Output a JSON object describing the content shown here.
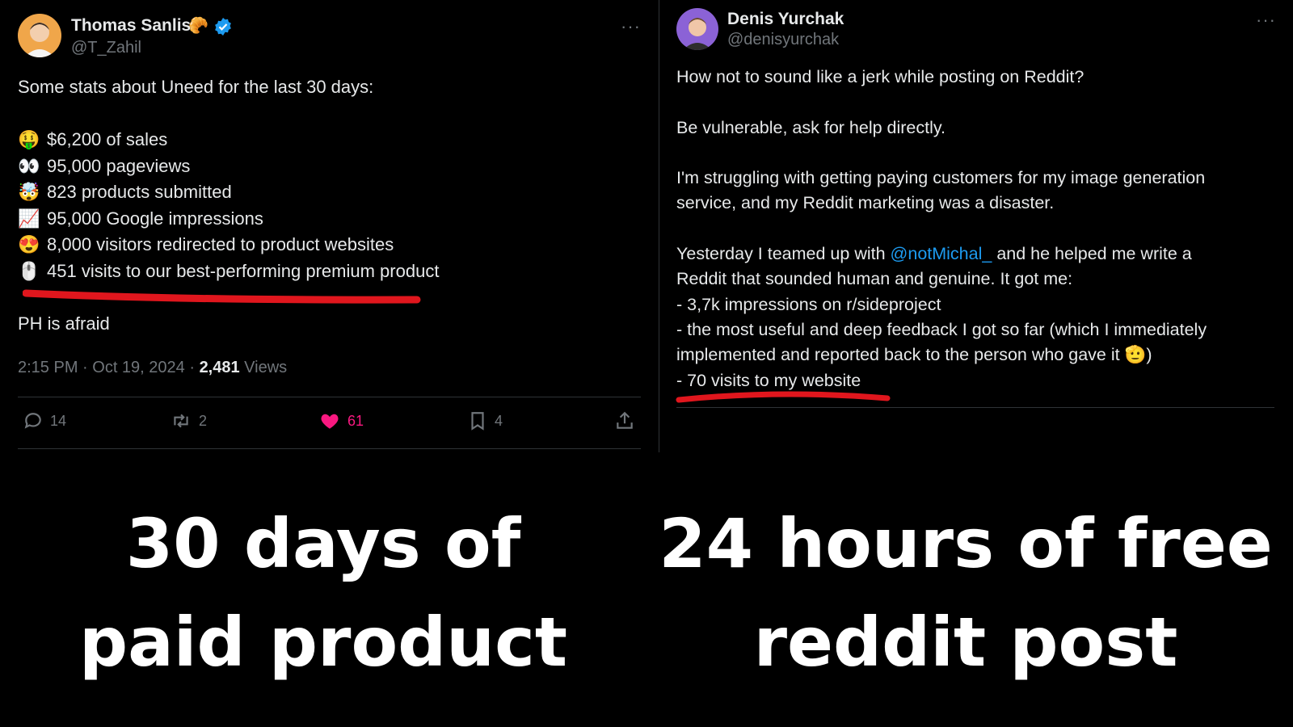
{
  "left_tweet": {
    "author": {
      "name": "Thomas Sanlis",
      "handle": "@T_Zahil",
      "name_emoji": "🥐"
    },
    "more_label": "···",
    "intro": "Some stats about Uneed for the last 30 days:",
    "stats": [
      {
        "icon": "money-face-icon",
        "emoji": "🤑",
        "text": "$6,200 of sales"
      },
      {
        "icon": "eyes-icon",
        "emoji": "👀",
        "text": "95,000 pageviews"
      },
      {
        "icon": "mind-blown-icon",
        "emoji": "🤯",
        "text": "823 products submitted"
      },
      {
        "icon": "chart-up-icon",
        "emoji": "📈",
        "text": "95,000 Google impressions"
      },
      {
        "icon": "heart-eyes-icon",
        "emoji": "😍",
        "text": "8,000 visitors redirected to product websites"
      },
      {
        "icon": "mouse-icon",
        "emoji": "🖱️",
        "text": "451 visits to our best-performing premium product"
      }
    ],
    "closing": "PH is afraid",
    "timestamp": "2:15 PM · Oct 19, 2024 · ",
    "views_count": "2,481",
    "views_label": " Views",
    "actions": {
      "replies": "14",
      "reposts": "2",
      "likes": "61",
      "bookmarks": "4"
    },
    "colors": {
      "like": "#f91880",
      "underline": "#e0161d"
    }
  },
  "right_tweet": {
    "author": {
      "name": "Denis Yurchak",
      "handle": "@denisyurchak"
    },
    "more_label": "···",
    "para1": "How not to sound like a jerk while posting on Reddit?",
    "para2": "Be vulnerable, ask for help directly.",
    "para3_line1": "I'm struggling with getting paying customers for my image generation",
    "para3_line2": "service, and my Reddit marketing was a disaster.",
    "para4_prefix": "Yesterday I teamed up with ",
    "mention": "@notMichal_",
    "para4_suffix": " and he helped me write a",
    "para4_line2": "Reddit that sounded human and genuine. It got me:",
    "bullet1": "- 3,7k impressions on r/sideproject",
    "bullet2_line1": "- the most useful and deep feedback I got so far (which I immediately",
    "bullet2_line2": "implemented and reported back to the person who gave it",
    "bullet2_emoji": "🫡",
    "bullet2_close": ")",
    "bullet3": "- 70 visits to my website"
  },
  "captions": {
    "left_line1": "30 days of",
    "left_line2": "paid product",
    "right_line1": "24 hours of free",
    "right_line2": "reddit post"
  }
}
